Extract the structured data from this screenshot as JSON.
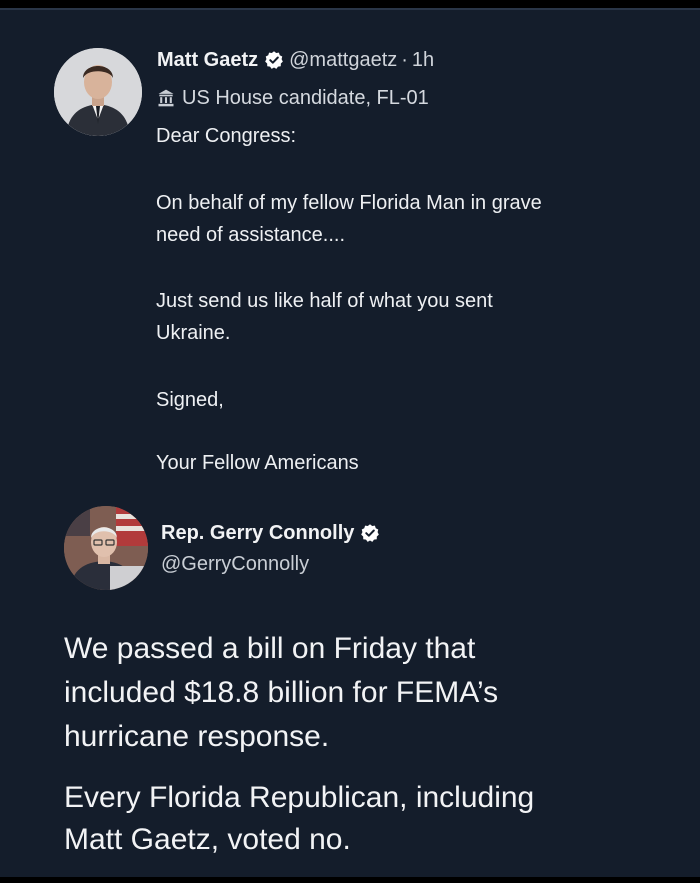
{
  "tweet1": {
    "name": "Matt Gaetz",
    "handle": "@mattgaetz",
    "separator": "·",
    "time": "1h",
    "label": "US House candidate, FL-01",
    "lines": [
      "Dear Congress:",
      "On behalf of my fellow Florida Man in grave",
      "need of assistance....",
      "Just send us like half of what you sent",
      "Ukraine.",
      "Signed,",
      "Your Fellow Americans"
    ],
    "icons": {
      "verified": "verified-badge-icon",
      "label": "government-building-icon"
    }
  },
  "tweet2": {
    "name": "Rep. Gerry Connolly",
    "handle": "@GerryConnolly",
    "lines": [
      "We passed a bill on Friday that",
      "included $18.8 billion for FEMA’s",
      "hurricane response.",
      "Every Florida Republican, including",
      "Matt Gaetz, voted no."
    ],
    "icons": {
      "verified": "verified-badge-icon"
    }
  },
  "colors": {
    "background": "#141d2b",
    "text": "#eef0f3",
    "verified_fill": "#ffffff"
  }
}
